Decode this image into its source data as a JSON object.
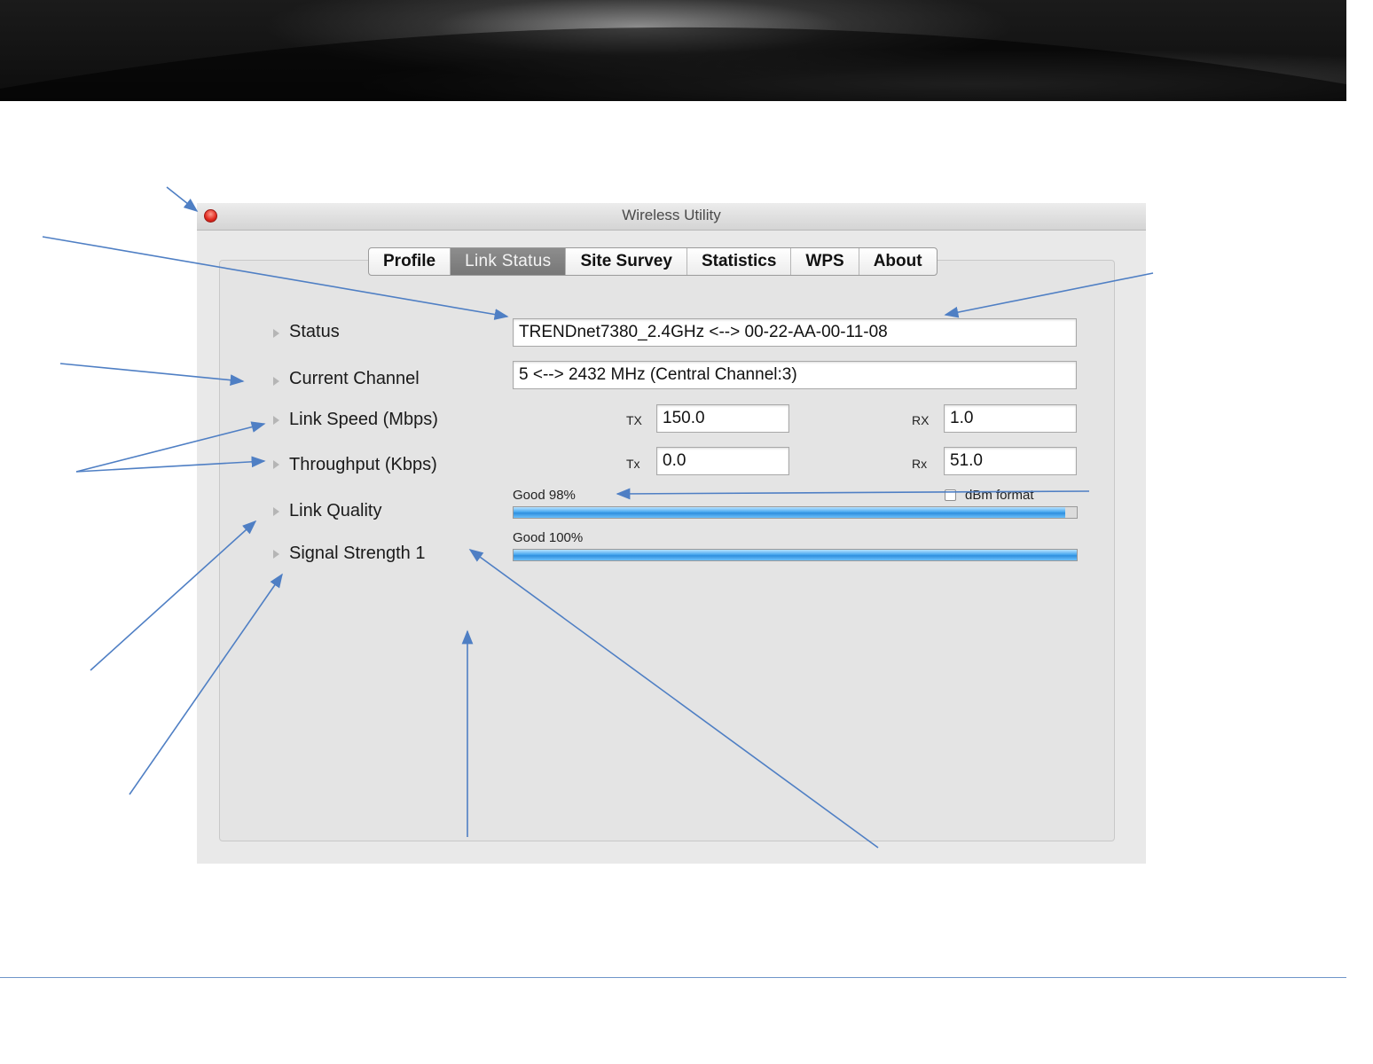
{
  "window": {
    "title": "Wireless Utility"
  },
  "tabs": [
    {
      "label": "Profile",
      "active": false
    },
    {
      "label": "Link Status",
      "active": true
    },
    {
      "label": "Site Survey",
      "active": false
    },
    {
      "label": "Statistics",
      "active": false
    },
    {
      "label": "WPS",
      "active": false
    },
    {
      "label": "About",
      "active": false
    }
  ],
  "link_status": {
    "status_label": "Status",
    "status_value": "TRENDnet7380_2.4GHz <--> 00-22-AA-00-11-08",
    "channel_label": "Current Channel",
    "channel_value": "5 <--> 2432 MHz (Central Channel:3)",
    "link_speed_label": "Link Speed (Mbps)",
    "link_speed_tx_label": "TX",
    "link_speed_tx": "150.0",
    "link_speed_rx_label": "RX",
    "link_speed_rx": "1.0",
    "throughput_label": "Throughput (Kbps)",
    "throughput_tx_label": "Tx",
    "throughput_tx": "0.0",
    "throughput_rx_label": "Rx",
    "throughput_rx": "51.0",
    "link_quality_label": "Link Quality",
    "link_quality_text": "Good 98%",
    "link_quality_percent": 98,
    "dbm_format_label": "dBm format",
    "dbm_format_checked": false,
    "signal_strength_label": "Signal Strength 1",
    "signal_strength_text": "Good 100%",
    "signal_strength_percent": 100
  },
  "colors": {
    "annotation_arrow": "#4f7fc4",
    "progress_fill": "#3b9be6"
  }
}
